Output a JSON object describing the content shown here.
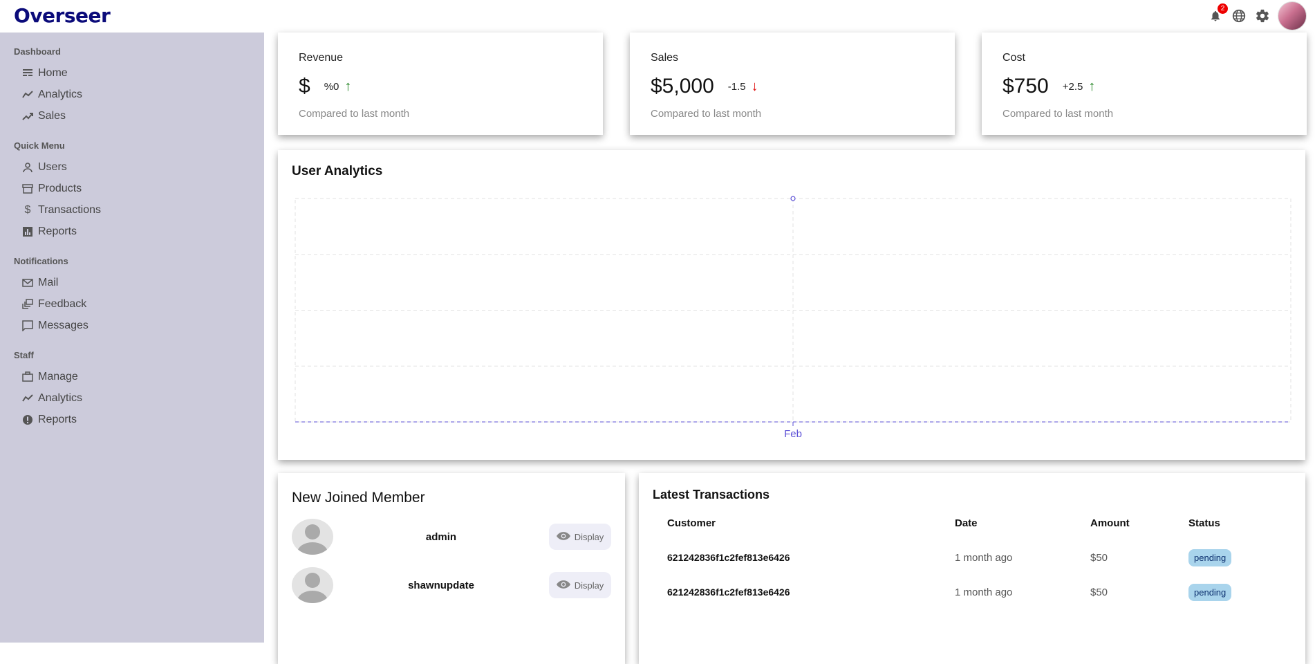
{
  "app": {
    "logo": "Overseer",
    "notification_count": "2"
  },
  "sidebar": {
    "sections": [
      {
        "title": "Dashboard",
        "items": [
          {
            "label": "Home",
            "icon": "home-icon"
          },
          {
            "label": "Analytics",
            "icon": "trending-icon"
          },
          {
            "label": "Sales",
            "icon": "trending-up-icon"
          }
        ]
      },
      {
        "title": "Quick Menu",
        "items": [
          {
            "label": "Users",
            "icon": "user-icon"
          },
          {
            "label": "Products",
            "icon": "storefront-icon"
          },
          {
            "label": "Transactions",
            "icon": "dollar-icon"
          },
          {
            "label": "Reports",
            "icon": "bar-chart-icon"
          }
        ]
      },
      {
        "title": "Notifications",
        "items": [
          {
            "label": "Mail",
            "icon": "mail-icon"
          },
          {
            "label": "Feedback",
            "icon": "dynamic-feed-icon"
          },
          {
            "label": "Messages",
            "icon": "chat-bubble-icon"
          }
        ]
      },
      {
        "title": "Staff",
        "items": [
          {
            "label": "Manage",
            "icon": "briefcase-icon"
          },
          {
            "label": "Analytics",
            "icon": "timeline-icon"
          },
          {
            "label": "Reports",
            "icon": "report-icon"
          }
        ]
      }
    ]
  },
  "kpis": [
    {
      "title": "Revenue",
      "value": "$",
      "rate": "%0",
      "direction": "up",
      "sub": "Compared to last month"
    },
    {
      "title": "Sales",
      "value": "$5,000",
      "rate": "-1.5",
      "direction": "down",
      "sub": "Compared to last month"
    },
    {
      "title": "Cost",
      "value": "$750",
      "rate": "+2.5",
      "direction": "up",
      "sub": "Compared to last month"
    }
  ],
  "colors": {
    "up": "#1a7f1a",
    "down": "#e01010",
    "chart_line": "#5b4fd6",
    "sidebar_bg": "#cccbdb",
    "logo": "#0b0b7a"
  },
  "analytics": {
    "title": "User Analytics"
  },
  "chart_data": {
    "type": "line",
    "title": "User Analytics",
    "x": [
      "Feb"
    ],
    "series": [
      {
        "values": [
          1
        ]
      }
    ],
    "grid": true,
    "ylim": [
      0,
      1
    ]
  },
  "members": {
    "title": "New Joined Member",
    "button_label": "Display",
    "items": [
      {
        "name": "admin"
      },
      {
        "name": "shawnupdate"
      }
    ]
  },
  "transactions": {
    "title": "Latest Transactions",
    "headers": {
      "customer": "Customer",
      "date": "Date",
      "amount": "Amount",
      "status": "Status"
    },
    "rows": [
      {
        "customer": "621242836f1c2fef813e6426",
        "date": "1 month ago",
        "amount": "$50",
        "status": "pending"
      },
      {
        "customer": "621242836f1c2fef813e6426",
        "date": "1 month ago",
        "amount": "$50",
        "status": "pending"
      }
    ]
  }
}
